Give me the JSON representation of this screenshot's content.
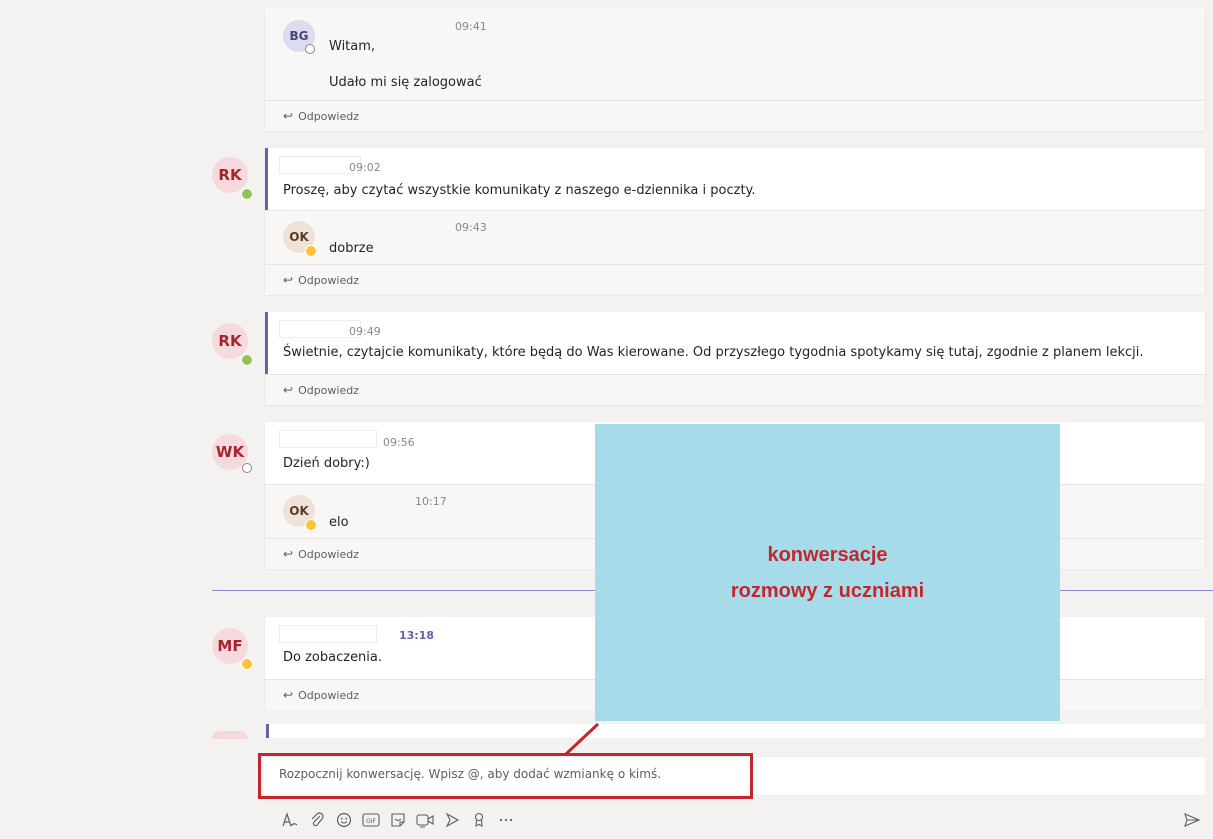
{
  "threads": [
    {
      "avatar": "",
      "time": "",
      "message": "",
      "reply_to": {
        "initials": "BG",
        "time": "09:41",
        "lines": [
          "Witam,",
          "Udało mi się zalogować"
        ]
      },
      "reply_label": "Odpowiedz"
    },
    {
      "avatar": "RK",
      "time": "09:02",
      "message": "Proszę, aby czytać wszystkie komunikaty z naszego e-dziennika i poczty.",
      "reply": {
        "initials": "OK",
        "time": "09:43",
        "text": "dobrze"
      },
      "reply_label": "Odpowiedz"
    },
    {
      "avatar": "RK",
      "time": "09:49",
      "message": "Świetnie, czytajcie komunikaty, które będą do Was kierowane. Od przyszłego tygodnia spotykamy się tutaj, zgodnie z planem lekcji.",
      "reply_label": "Odpowiedz"
    },
    {
      "avatar": "WK",
      "time": "09:56",
      "message": "Dzień dobry:)",
      "reply": {
        "initials": "OK",
        "time": "10:17",
        "text": "elo"
      },
      "reply_label": "Odpowiedz"
    },
    {
      "avatar": "MF",
      "time": "13:18",
      "message": "Do zobaczenia.",
      "reply_label": "Odpowiedz"
    }
  ],
  "overlay": {
    "line1": "konwersacje",
    "line2": "rozmowy z uczniami"
  },
  "compose": {
    "placeholder": "Rozpocznij konwersację. Wpisz @, aby dodać wzmiankę o kimś."
  },
  "toolbar_icons": [
    "format-icon",
    "attach-icon",
    "emoji-icon",
    "gif-icon",
    "sticker-icon",
    "meet-icon",
    "praise-icon",
    "approvals-icon",
    "more-icon"
  ],
  "colors": {
    "accent": "#6264a7",
    "highlight": "#c4262e",
    "overlay": "#a6dbe9"
  }
}
